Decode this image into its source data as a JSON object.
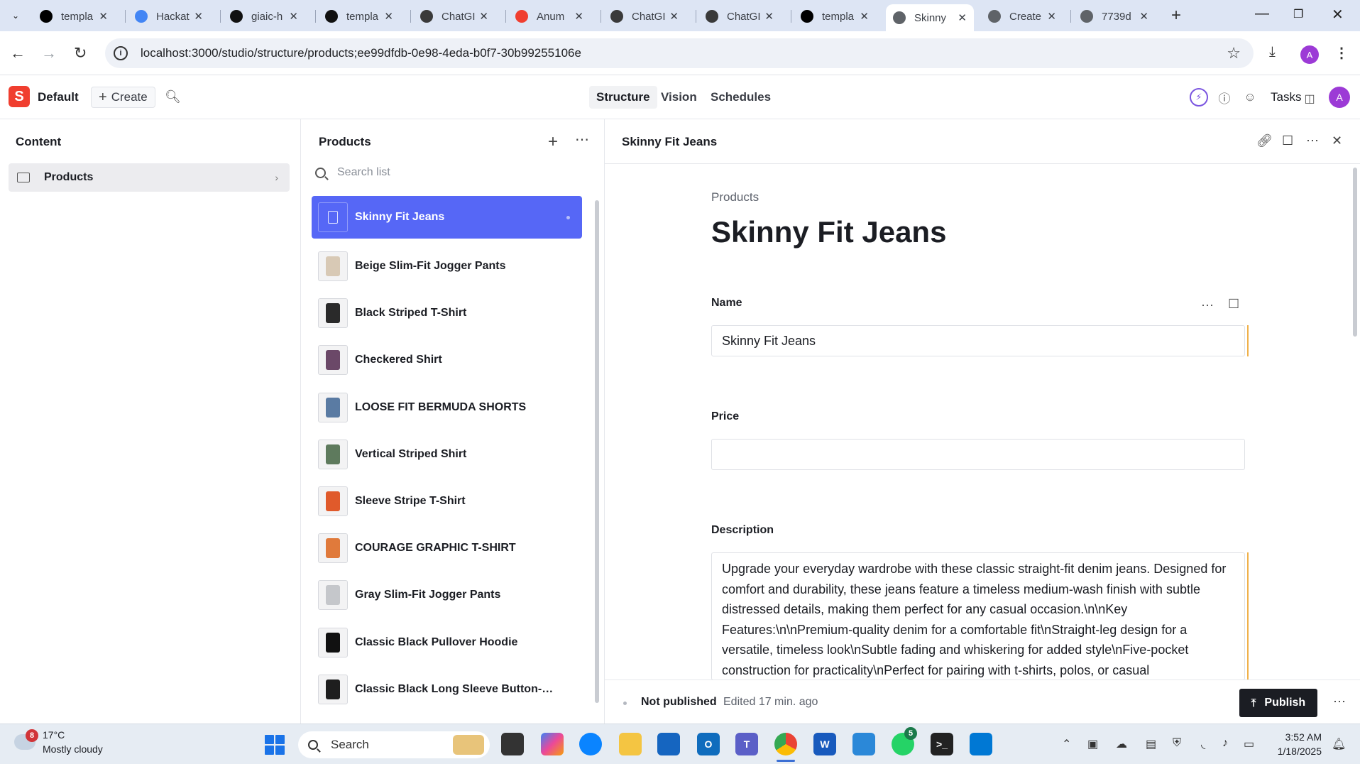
{
  "browser": {
    "tabs": [
      {
        "title": "templa",
        "icon": "vercel-icon",
        "color": "#000000"
      },
      {
        "title": "Hackat",
        "icon": "docs-icon",
        "color": "#4285f4"
      },
      {
        "title": "giaic-h",
        "icon": "github-icon",
        "color": "#111111"
      },
      {
        "title": "templa",
        "icon": "github-icon",
        "color": "#111111"
      },
      {
        "title": "ChatGI",
        "icon": "openai-icon",
        "color": "#3a3a3a"
      },
      {
        "title": "Anum",
        "icon": "sanity-icon",
        "color": "#f03e2f"
      },
      {
        "title": "ChatGI",
        "icon": "openai-icon",
        "color": "#3a3a3a"
      },
      {
        "title": "ChatGI",
        "icon": "openai-icon",
        "color": "#3a3a3a"
      },
      {
        "title": "templa",
        "icon": "vercel-icon",
        "color": "#000000"
      },
      {
        "title": "Skinny",
        "icon": "globe-icon",
        "color": "#5f6368",
        "active": true
      },
      {
        "title": "Create",
        "icon": "globe-icon",
        "color": "#5f6368"
      },
      {
        "title": "7739d",
        "icon": "globe-icon",
        "color": "#5f6368"
      }
    ],
    "url": "localhost:3000/studio/structure/products;ee99dfdb-0e98-4eda-b0f7-30b99255106e",
    "profile_initial": "A"
  },
  "studio": {
    "workspace": "Default",
    "logo_letter": "S",
    "create_label": "Create",
    "modes": [
      "Structure",
      "Vision",
      "Schedules"
    ],
    "selected_mode": "Structure",
    "tasks_label": "Tasks",
    "user_initial": "A",
    "accent": "#5667f6",
    "brand": "#f03e2f"
  },
  "content_pane": {
    "title": "Content",
    "items": [
      {
        "label": "Products",
        "icon": "folder-icon"
      }
    ]
  },
  "list_pane": {
    "title": "Products",
    "search_placeholder": "Search list",
    "items": [
      {
        "name": "Skinny Fit Jeans",
        "thumb": "document-icon",
        "active": true
      },
      {
        "name": "Beige Slim-Fit Jogger Pants",
        "thumb": "#d8c9b5"
      },
      {
        "name": "Black Striped T-Shirt",
        "thumb": "#2a2a2a"
      },
      {
        "name": "Checkered Shirt",
        "thumb": "#6b4868"
      },
      {
        "name": "LOOSE FIT BERMUDA SHORTS",
        "thumb": "#5a7ba3"
      },
      {
        "name": "Vertical Striped Shirt",
        "thumb": "#5e7a5d"
      },
      {
        "name": "Sleeve Stripe T-Shirt",
        "thumb": "#e05a2b"
      },
      {
        "name": "COURAGE GRAPHIC T-SHIRT",
        "thumb": "#e07a3b"
      },
      {
        "name": "Gray Slim-Fit Jogger Pants",
        "thumb": "#c5c7cb"
      },
      {
        "name": "Classic Black Pullover Hoodie",
        "thumb": "#111111"
      },
      {
        "name": "Classic Black Long Sleeve Button-Do...",
        "thumb": "#1e1e1e"
      }
    ]
  },
  "document": {
    "header_title": "Skinny Fit Jeans",
    "breadcrumb": "Products",
    "heading": "Skinny Fit Jeans",
    "fields": {
      "name_label": "Name",
      "name_value": "Skinny Fit Jeans",
      "price_label": "Price",
      "price_value": "",
      "description_label": "Description",
      "description_value": "Upgrade your everyday wardrobe with these classic straight-fit denim jeans. Designed for comfort and durability, these jeans feature a timeless medium-wash finish with subtle distressed details, making them perfect for any casual occasion.\\n\\nKey Features:\\n\\nPremium-quality denim for a comfortable fit\\nStraight-leg design for a versatile, timeless look\\nSubtle fading and whiskering for added style\\nFive-pocket construction for practicality\\nPerfect for pairing with t-shirts, polos, or casual"
    },
    "status": "Not published",
    "edited": "Edited 17 min. ago",
    "publish_label": "Publish"
  },
  "taskbar": {
    "weather_badge": "8",
    "temperature": "17°C",
    "condition": "Mostly cloudy",
    "search_label": "Search",
    "whatsapp_badge": "5",
    "time": "3:52 AM",
    "date": "1/18/2025"
  }
}
